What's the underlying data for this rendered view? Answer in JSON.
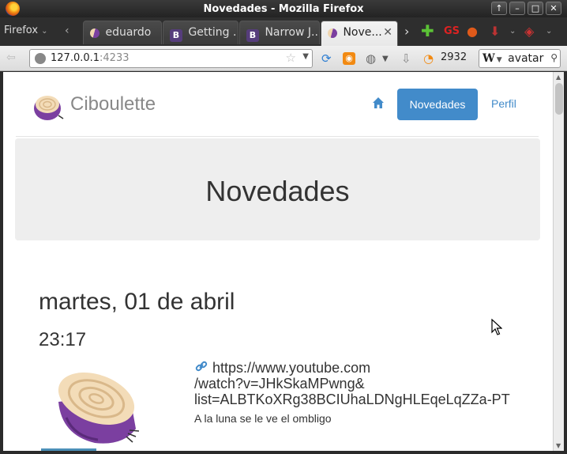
{
  "window": {
    "title": "Novedades - Mozilla Firefox"
  },
  "titlebar_buttons": [
    "↑",
    "–",
    "□",
    "✕"
  ],
  "tabbar": {
    "menu_label": "Firefox",
    "tabs": [
      {
        "label": "eduardo",
        "icon": "onion-favicon"
      },
      {
        "label": "Getting ...",
        "icon": "bootstrap-favicon",
        "icon_text": "B"
      },
      {
        "label": "Narrow J...",
        "icon": "bootstrap-favicon",
        "icon_text": "B"
      },
      {
        "label": "Nove...",
        "icon": "onion-favicon",
        "active": true
      }
    ],
    "tab_close": "✕",
    "gs_label": "GS"
  },
  "navbar": {
    "url_host": "127.0.0.1",
    "url_port": ":4233",
    "count": "2932",
    "search_engine": "W",
    "search_value": "avatar"
  },
  "site": {
    "brand": "Ciboulette",
    "nav_active": "Novedades",
    "nav_profile": "Perfil",
    "jumbotron_title": "Novedades",
    "post": {
      "date": "martes, 01 de abril",
      "time": "23:17",
      "link_line1": "https://www.youtube.com",
      "link_line2": "/watch?v=JHkSkaMPwng&",
      "link_line3": "list=ALBTKoXRg38BCIUhaLDNgHLEqeLqZZa-PT",
      "description": "A la luna se le ve el ombligo"
    }
  },
  "colors": {
    "accent": "#428bca",
    "jumbotron_bg": "#eeeeee",
    "onion_purple": "#7b3fa0"
  }
}
